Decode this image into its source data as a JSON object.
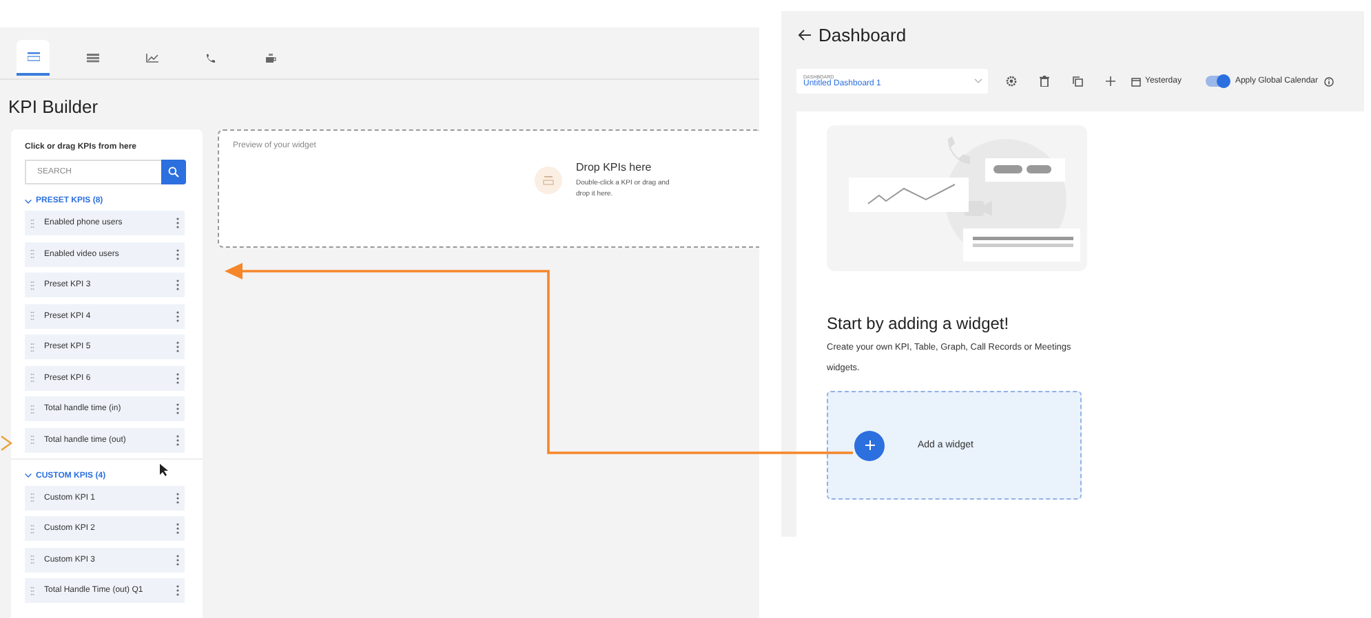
{
  "kpi_builder": {
    "tabs": [
      {
        "selected": true
      },
      {
        "selected": false
      },
      {
        "selected": false
      },
      {
        "selected": false
      },
      {
        "selected": false
      }
    ],
    "title": "KPI Builder",
    "sidebar": {
      "hint": "Click or drag KPIs from here",
      "search": {
        "placeholder": "SEARCH"
      },
      "groups": [
        {
          "label": "PRESET KPIS (8)",
          "expanded": true,
          "items": [
            "Enabled phone users",
            "Enabled video users",
            "Preset KPI 3",
            "Preset KPI 4",
            "Preset KPI 5",
            "Preset KPI 6",
            "Total handle time (in)",
            "Total handle time (out)"
          ]
        },
        {
          "label": "CUSTOM KPIS (4)",
          "expanded": true,
          "items": [
            "Custom KPI 1",
            "Custom KPI 2",
            "Custom KPI 3",
            "Total Handle Time (out) Q1"
          ]
        }
      ]
    },
    "preview": {
      "label": "Preview of your widget",
      "drop_title": "Drop KPIs here",
      "drop_hint": "Double-click a KPI or drag and drop it here."
    }
  },
  "dashboard": {
    "title": "Dashboard",
    "selector": {
      "label": "DASHBOARD",
      "value": "Untitled Dashboard 1"
    },
    "date": "Yesterday",
    "global_calendar": {
      "label": "Apply Global Calendar",
      "on": true
    },
    "empty": {
      "heading": "Start by adding a widget!",
      "text": "Create your own KPI, Table, Graph, Call Records or Meetings widgets.",
      "action": "Add a widget"
    }
  }
}
